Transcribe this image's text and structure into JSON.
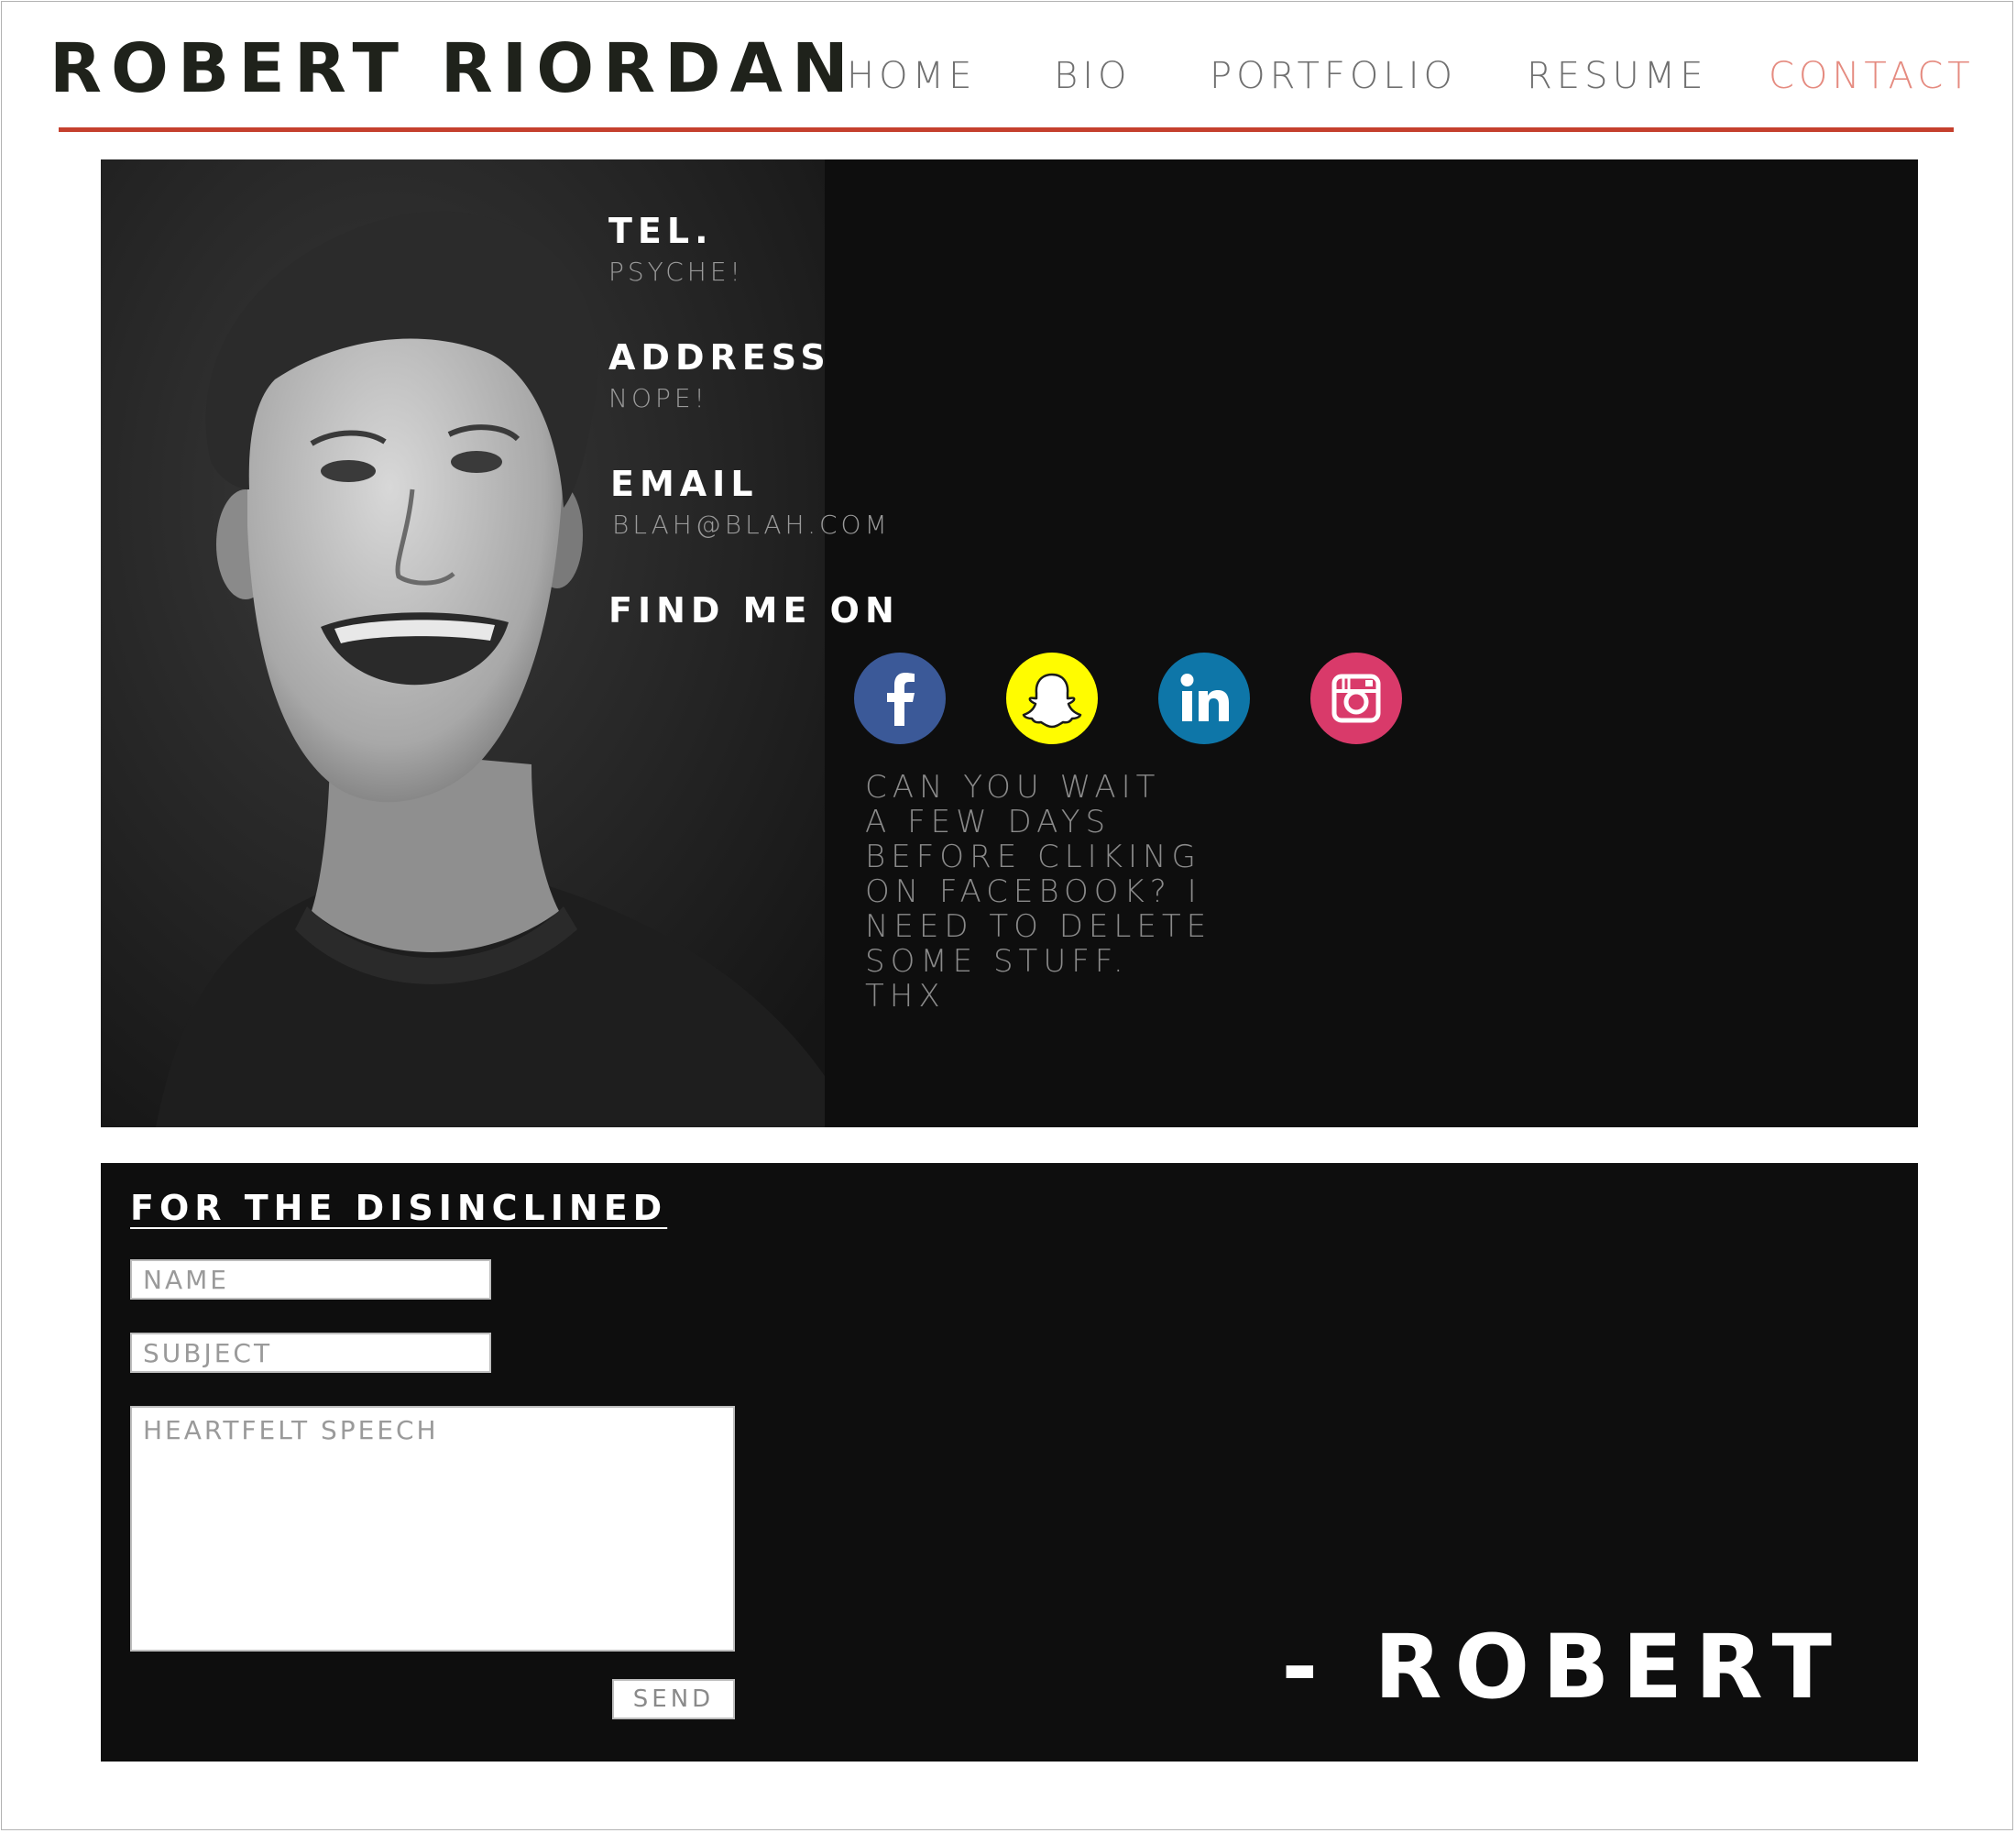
{
  "header": {
    "site_title": "ROBERT RIORDAN",
    "nav": [
      {
        "label": "HOME",
        "active": false
      },
      {
        "label": "BIO",
        "active": false
      },
      {
        "label": "PORTFOLIO",
        "active": false
      },
      {
        "label": "RESUME",
        "active": false
      },
      {
        "label": "CONTACT",
        "active": true
      }
    ],
    "accent_color": "#c5402d",
    "active_nav_color": "#e58b80"
  },
  "contact": {
    "tel_label": "TEL.",
    "tel_value": "PSYCHE!",
    "address_label": "ADDRESS",
    "address_value": "NOPE!",
    "email_label": "EMAIL",
    "email_value": "BLAH@BLAH.COM",
    "social_heading": "FIND ME ON",
    "social": [
      {
        "name": "facebook",
        "icon": "facebook-icon",
        "color": "#3b5998"
      },
      {
        "name": "snapchat",
        "icon": "snapchat-icon",
        "color": "#fffc00"
      },
      {
        "name": "linkedin",
        "icon": "linkedin-icon",
        "color": "#0e76a8"
      },
      {
        "name": "instagram",
        "icon": "instagram-icon",
        "color": "#d93a6a"
      }
    ],
    "note": "CAN YOU WAIT\nA FEW DAYS\nBEFORE CLIKING\nON FACEBOOK? I\nNEED TO DELETE\nSOME STUFF.\nTHX"
  },
  "form": {
    "heading": "FOR THE DISINCLINED",
    "name_placeholder": "NAME",
    "subject_placeholder": "SUBJECT",
    "message_placeholder": "HEARTFELT SPEECH",
    "send_label": "SEND",
    "signature": "- ROBERT"
  }
}
